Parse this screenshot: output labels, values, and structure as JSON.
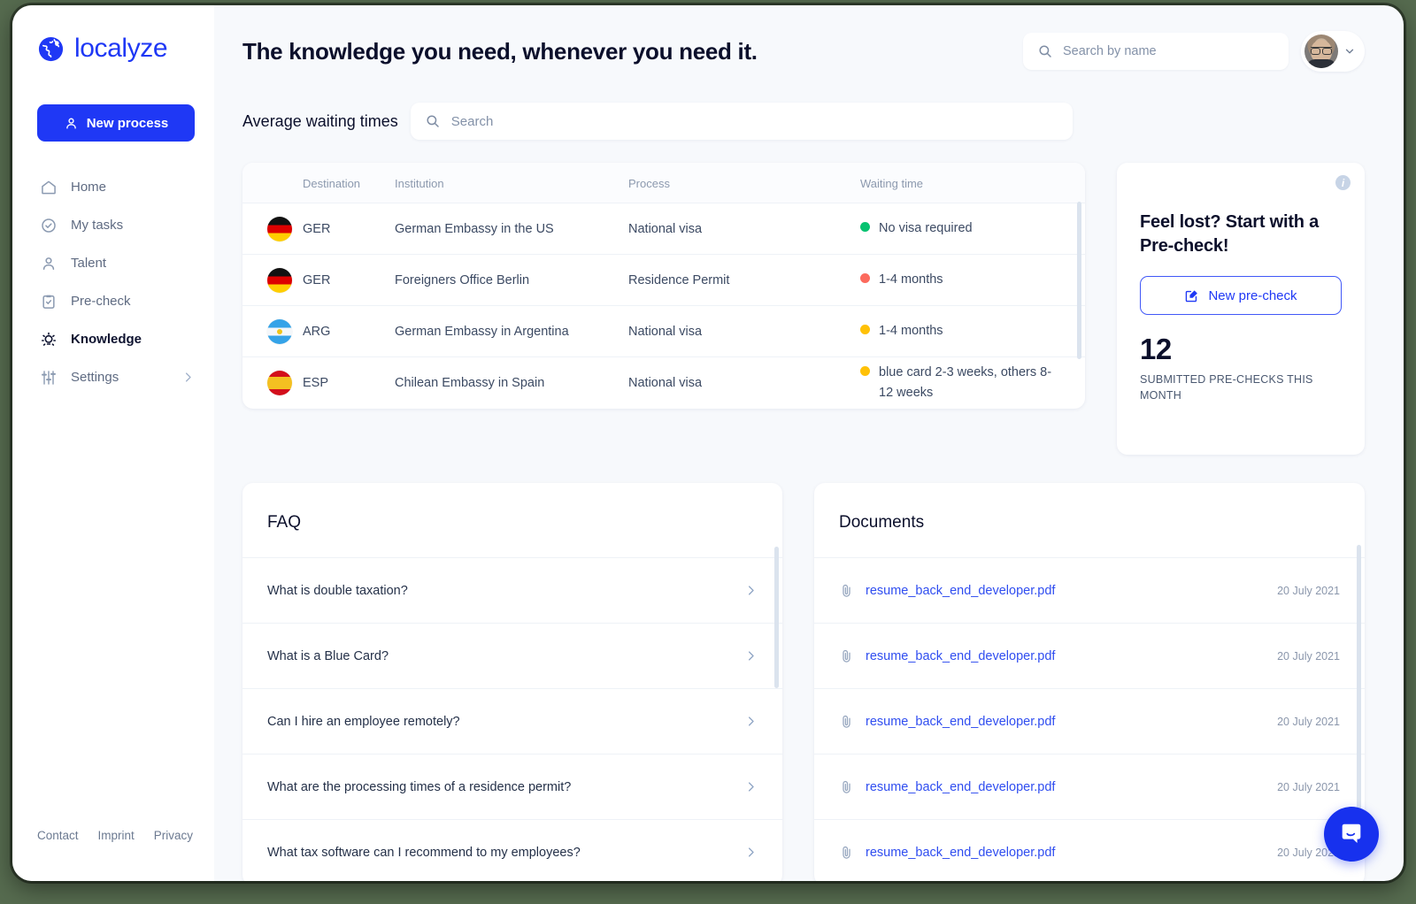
{
  "brand": {
    "name": "localyze",
    "logo_icon": "globe-icon"
  },
  "sidebar": {
    "new_process_label": "New process",
    "items": [
      {
        "label": "Home",
        "icon": "home-icon",
        "active": false
      },
      {
        "label": "My tasks",
        "icon": "check-circle-icon",
        "active": false
      },
      {
        "label": "Talent",
        "icon": "person-icon",
        "active": false
      },
      {
        "label": "Pre-check",
        "icon": "clipboard-check-icon",
        "active": false
      },
      {
        "label": "Knowledge",
        "icon": "lightbulb-icon",
        "active": true
      },
      {
        "label": "Settings",
        "icon": "sliders-icon",
        "active": false
      }
    ],
    "footer_links": [
      "Contact",
      "Imprint",
      "Privacy"
    ]
  },
  "header": {
    "title": "The knowledge you need, whenever you need it.",
    "search_placeholder": "Search by name",
    "search_value": "",
    "avatar_icon": "user-avatar",
    "chevron_icon": "chevron-down-icon"
  },
  "waiting_times": {
    "label": "Average waiting times",
    "search_placeholder": "Search",
    "search_value": "",
    "columns": [
      "",
      "Destination",
      "Institution",
      "Process",
      "Waiting time"
    ],
    "rows": [
      {
        "flag": "flag-ger",
        "destination": "GER",
        "institution": "German Embassy in the US",
        "process": "National visa",
        "waiting_time": "No visa required",
        "status_color": "#06c270"
      },
      {
        "flag": "flag-ger",
        "destination": "GER",
        "institution": "Foreigners Office Berlin",
        "process": "Residence Permit",
        "waiting_time": "1-4 months",
        "status_color": "#fc6a5d"
      },
      {
        "flag": "flag-arg",
        "destination": "ARG",
        "institution": "German Embassy in Argentina",
        "process": "National visa",
        "waiting_time": "1-4 months",
        "status_color": "#ffc107"
      },
      {
        "flag": "flag-esp",
        "destination": "ESP",
        "institution": "Chilean Embassy in Spain",
        "process": "National visa",
        "waiting_time": "blue card 2-3 weeks, others 8-12 weeks",
        "status_color": "#ffc107"
      }
    ]
  },
  "precheck": {
    "info_icon": "info-icon",
    "info_glyph": "i",
    "title": "Feel lost? Start with a Pre-check!",
    "button_label": "New pre-check",
    "button_icon": "edit-square-icon",
    "count": "12",
    "count_caption": "SUBMITTED PRE-CHECKS THIS MONTH"
  },
  "faq": {
    "title": "FAQ",
    "items": [
      "What is double taxation?",
      "What is a Blue Card?",
      "Can I hire an employee remotely?",
      "What are the processing times of a residence permit?",
      "What tax software can I recommend to my employees?"
    ],
    "chevron_icon": "chevron-right-icon"
  },
  "documents": {
    "title": "Documents",
    "attachment_icon": "paperclip-icon",
    "items": [
      {
        "name": "resume_back_end_developer.pdf",
        "date": "20 July 2021"
      },
      {
        "name": "resume_back_end_developer.pdf",
        "date": "20 July 2021"
      },
      {
        "name": "resume_back_end_developer.pdf",
        "date": "20 July 2021"
      },
      {
        "name": "resume_back_end_developer.pdf",
        "date": "20 July 2021"
      },
      {
        "name": "resume_back_end_developer.pdf",
        "date": "20 July 2021"
      }
    ]
  },
  "chat": {
    "icon": "chat-bubble-icon"
  },
  "colors": {
    "brand_blue": "#1f38f5",
    "link_blue": "#2f4df0",
    "page_bg": "#f7f9fc",
    "status_green": "#06c270",
    "status_red": "#fc6a5d",
    "status_yellow": "#ffc107"
  }
}
